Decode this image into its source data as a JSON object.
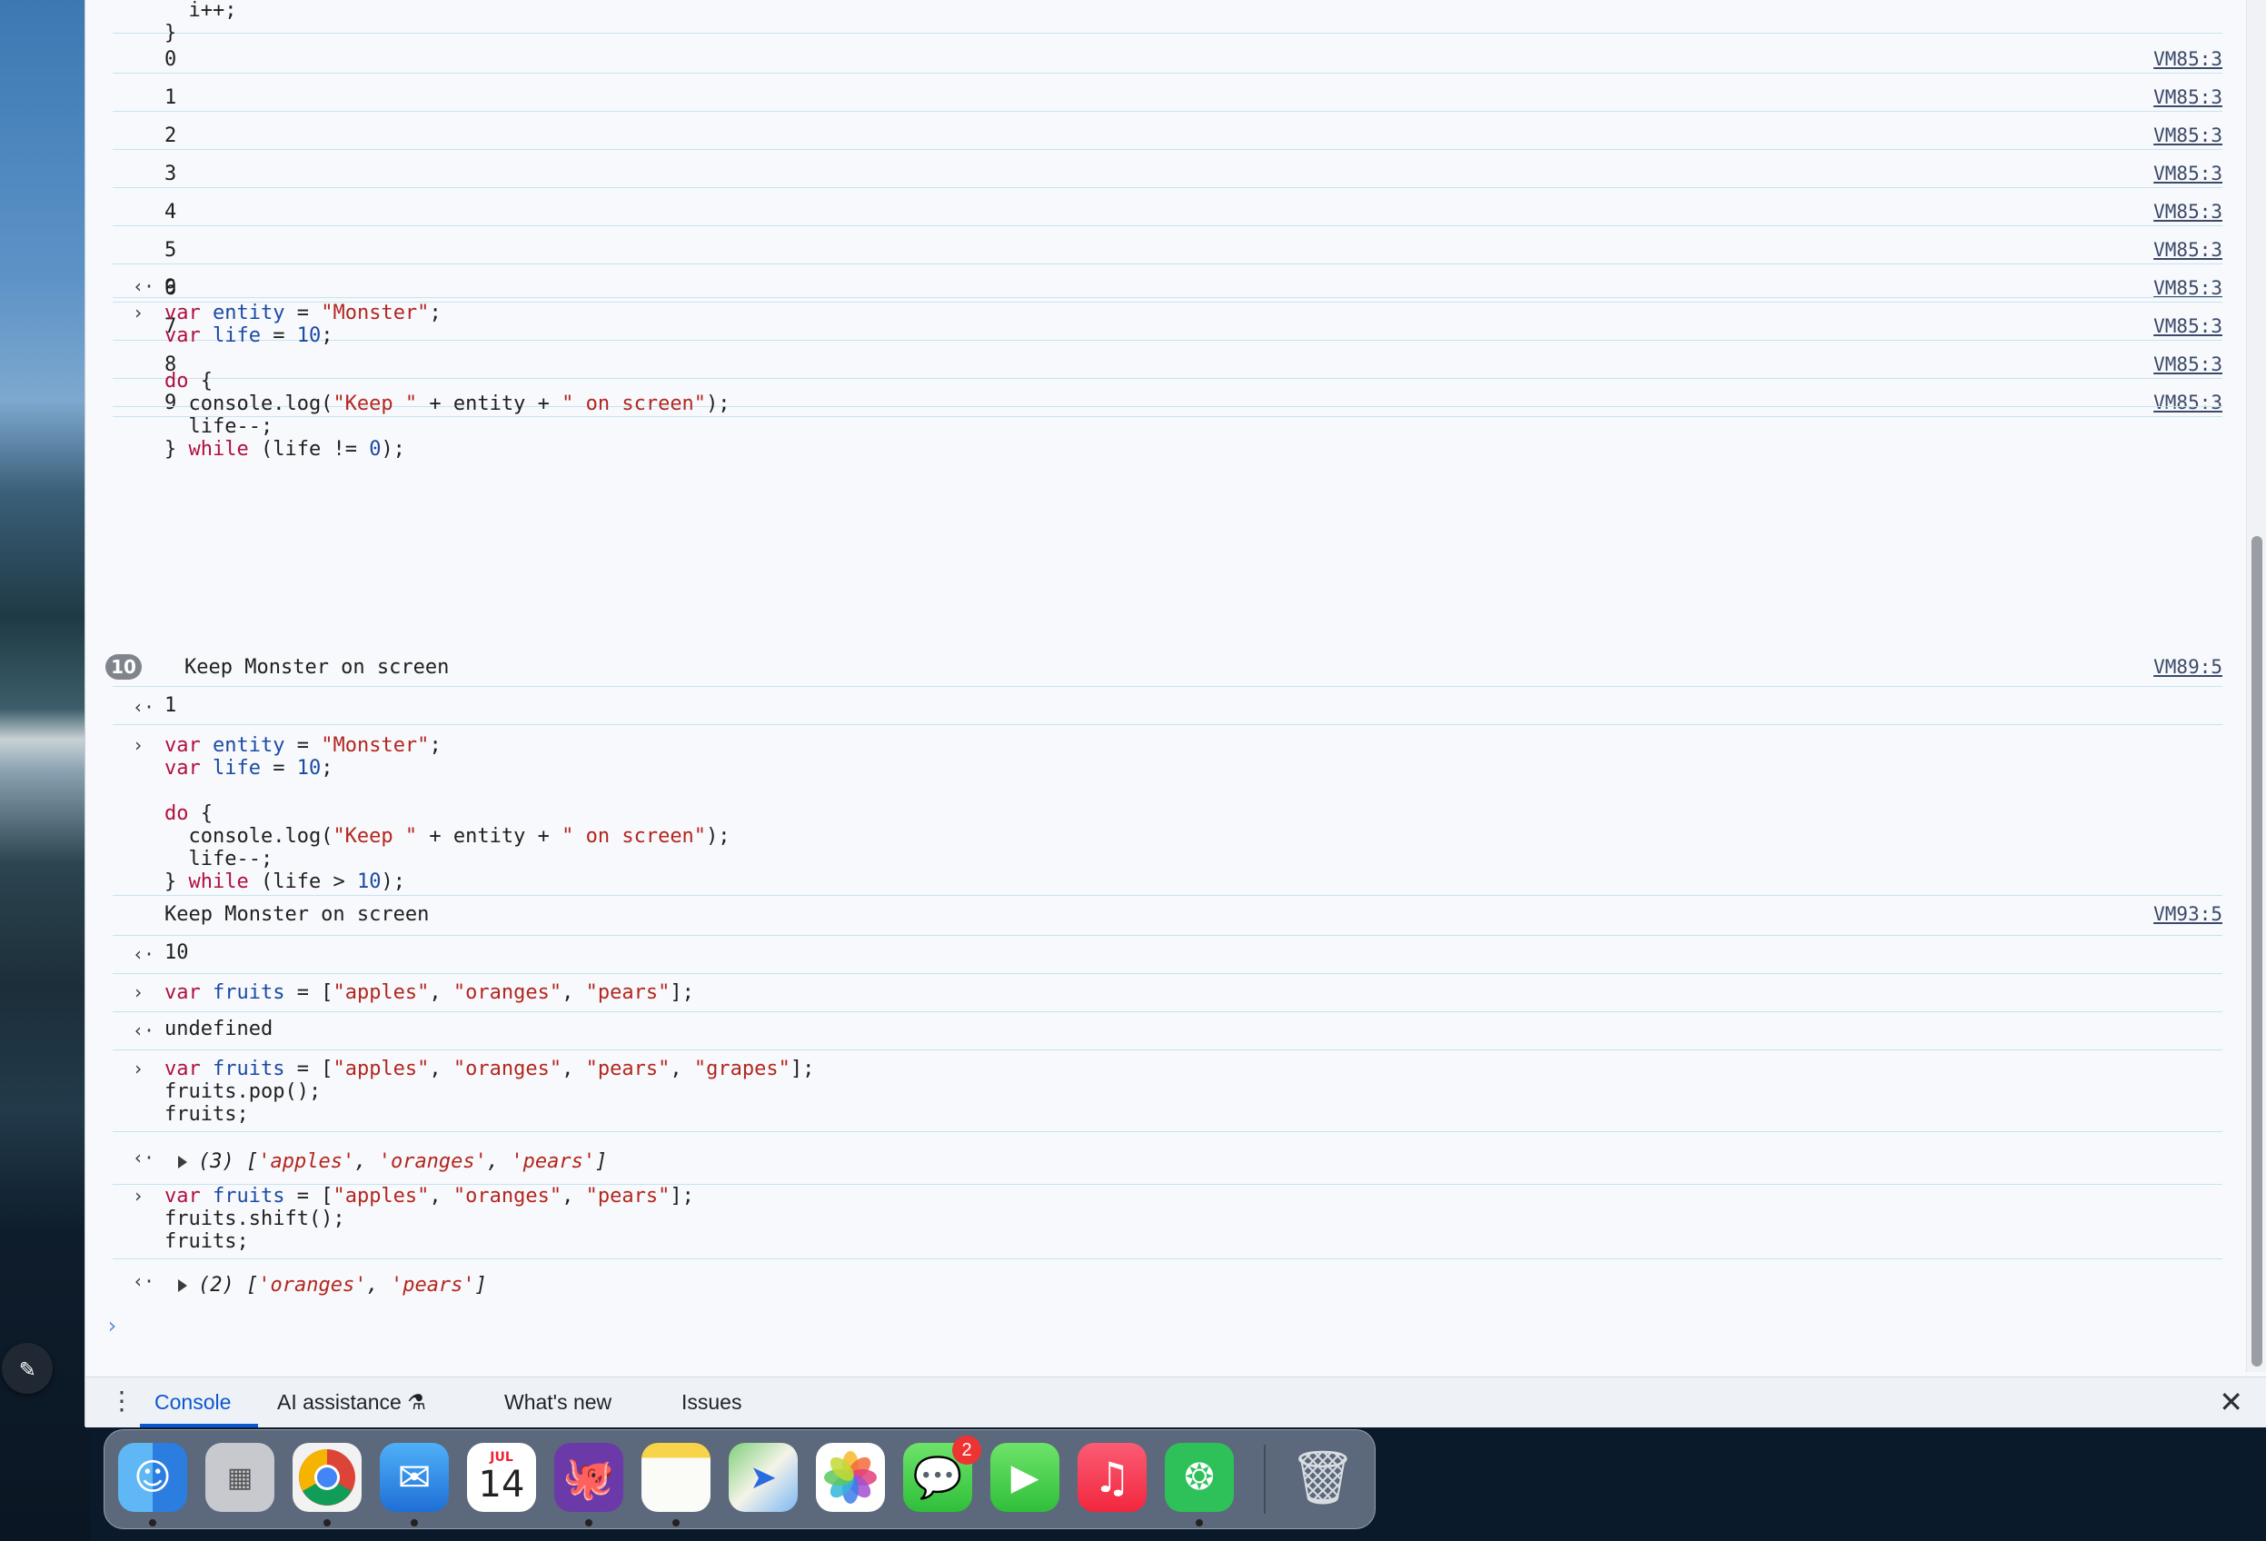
{
  "console": {
    "loop_tail": [
      "  i++;",
      "}"
    ],
    "log_rows": [
      "0",
      "1",
      "2",
      "3",
      "4",
      "5",
      "6",
      "7",
      "8",
      "9"
    ],
    "log_source": "VM85:3",
    "result_1": "9",
    "block1": {
      "line1": [
        "var ",
        "entity",
        " = ",
        "\"Monster\"",
        ";"
      ],
      "line2": [
        "var ",
        "life",
        " = ",
        "10",
        ";"
      ],
      "line3": [
        "do",
        " {"
      ],
      "line4": [
        "  console.log(",
        "\"Keep \"",
        " + entity + ",
        "\" on screen\"",
        ");"
      ],
      "line5": "  life--;",
      "line6": [
        "} ",
        "while",
        " (life != ",
        "0",
        ");"
      ]
    },
    "repeat_count": "10",
    "message_1": "Keep Monster on screen",
    "message_1_source": "VM89:5",
    "result_2": "1",
    "block2": {
      "line1": [
        "var ",
        "entity",
        " = ",
        "\"Monster\"",
        ";"
      ],
      "line2": [
        "var ",
        "life",
        " = ",
        "10",
        ";"
      ],
      "line3": [
        "do",
        " {"
      ],
      "line4": [
        "  console.log(",
        "\"Keep \"",
        " + entity + ",
        "\" on screen\"",
        ");"
      ],
      "line5": "  life--;",
      "line6": [
        "} ",
        "while",
        " (life > ",
        "10",
        ");"
      ]
    },
    "message_2": "Keep Monster on screen",
    "message_2_source": "VM93:5",
    "result_3": "10",
    "block3": [
      "var ",
      "fruits",
      " = [",
      "\"apples\"",
      ", ",
      "\"oranges\"",
      ", ",
      "\"pears\"",
      "];"
    ],
    "result_4": "undefined",
    "block4": {
      "line1": [
        "var ",
        "fruits",
        " = [",
        "\"apples\"",
        ", ",
        "\"oranges\"",
        ", ",
        "\"pears\"",
        ", ",
        "\"grapes\"",
        "];"
      ],
      "line2": "fruits.pop();",
      "line3": "fruits;"
    },
    "result_5": {
      "prefix": "(3) [",
      "items": [
        "'apples'",
        ", ",
        "'oranges'",
        ", ",
        "'pears'"
      ],
      "suffix": "]"
    },
    "block5": {
      "line1": [
        "var ",
        "fruits",
        " = [",
        "\"apples\"",
        ", ",
        "\"oranges\"",
        ", ",
        "\"pears\"",
        "];"
      ],
      "line2": "fruits.shift();",
      "line3": "fruits;"
    },
    "result_6": {
      "prefix": "(2) [",
      "items": [
        "'oranges'",
        ", ",
        "'pears'"
      ],
      "suffix": "]"
    },
    "prompt_glyph": "›"
  },
  "drawer": {
    "tabs": [
      "Console",
      "AI assistance",
      "What's new",
      "Issues"
    ],
    "active_tab": "Console"
  },
  "dock": {
    "calendar_month": "JUL",
    "calendar_day": "14",
    "messages_badge": "2",
    "apps": [
      "Finder",
      "Launchpad",
      "Chrome",
      "Mail",
      "Calendar",
      "GitHub Desktop",
      "Notes",
      "Maps",
      "Photos",
      "Messages",
      "FaceTime",
      "Music",
      "WeChat",
      "Trash"
    ]
  },
  "colors": {
    "panel_bg": "#f8f9fc",
    "row_border": "#c6e4ee",
    "keyword": "#b0103e",
    "string": "#b3261e",
    "number": "#1a4aa3",
    "active_tab": "#0b57d0"
  }
}
